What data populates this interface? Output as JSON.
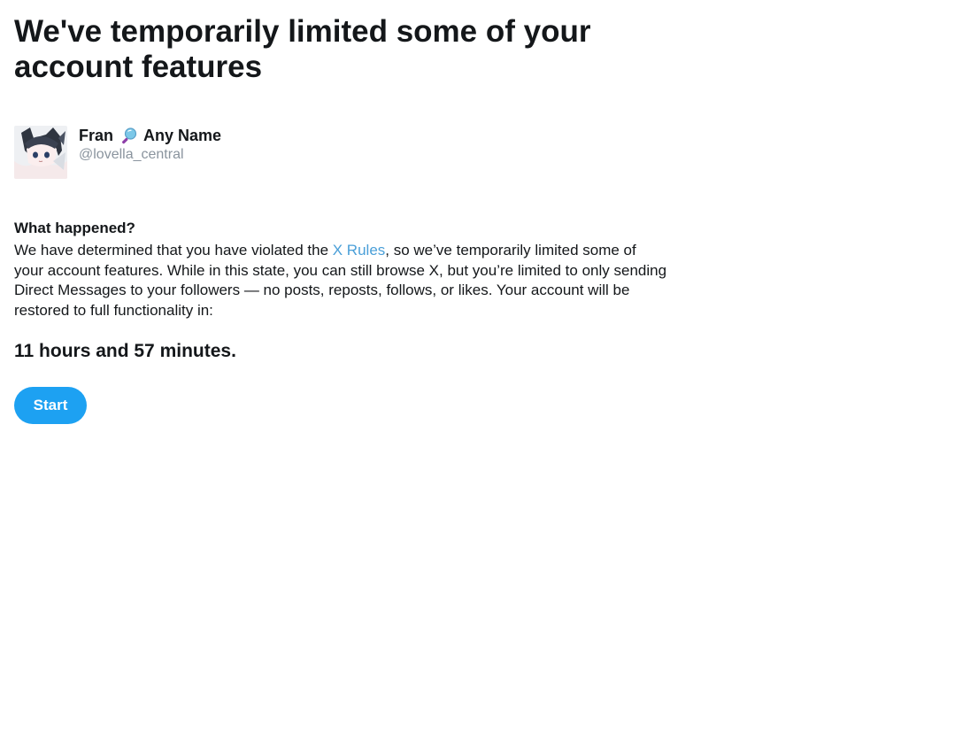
{
  "page": {
    "title": "We've temporarily limited some of your account features"
  },
  "profile": {
    "name_first": "Fran",
    "name_icon": "magnifying-glass-icon",
    "name_second": "Any Name",
    "handle": "@lovella_central"
  },
  "notice": {
    "heading": "What happened?",
    "text_before_link": "We have determined that you have violated the ",
    "link_label": "X Rules",
    "text_after_link": ", so we’ve temporarily limited some of your account features. While in this state, you can still browse X, but you’re limited to only sending Direct Messages to your followers — no posts, reposts, follows, or likes. Your account will be restored to full functionality in:",
    "countdown": "11 hours and 57 minutes."
  },
  "actions": {
    "start_label": "Start"
  },
  "colors": {
    "primary_button": "#1da1f2",
    "link": "#4a9fd8",
    "handle": "#8a949e",
    "text": "#14171a"
  }
}
